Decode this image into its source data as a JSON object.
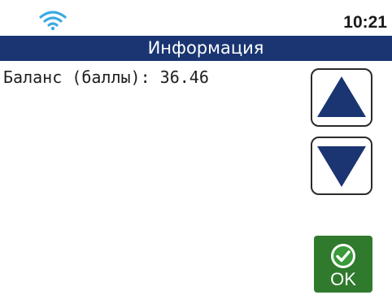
{
  "status_bar": {
    "time": "10:21",
    "wifi_icon": "wifi-icon",
    "wifi_color": "#3da9e3"
  },
  "header": {
    "title": "Информация",
    "background": "#1a3572"
  },
  "content": {
    "balance_line": "Баланс (баллы): 36.46"
  },
  "buttons": {
    "up_icon": "arrow-up-icon",
    "down_icon": "arrow-down-icon",
    "ok_label": "OK",
    "ok_icon": "check-circle-icon",
    "ok_color": "#2f7a2c",
    "arrow_color": "#1a3572"
  }
}
